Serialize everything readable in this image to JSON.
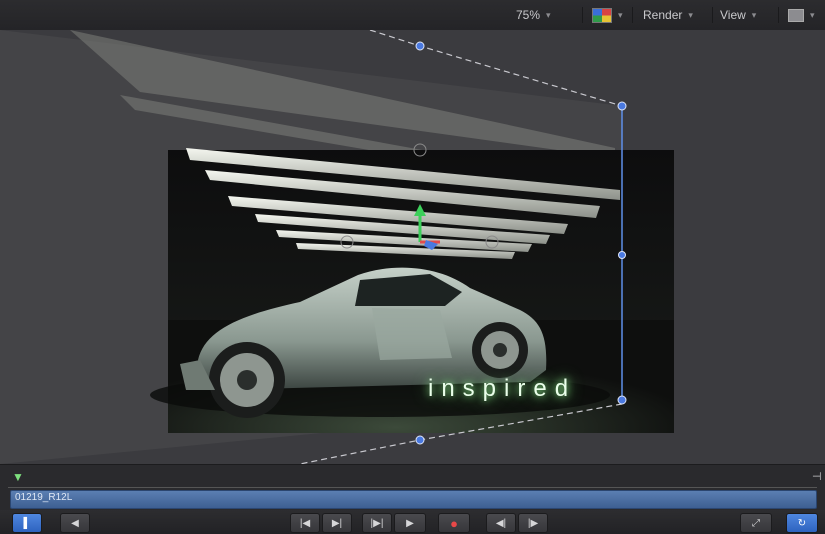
{
  "toolbar": {
    "zoom": "75%",
    "render_label": "Render",
    "view_label": "View"
  },
  "canvas": {
    "text_layer": "inspired"
  },
  "timeline": {
    "clip_label": "01219_R12L"
  },
  "icons": {
    "chevron": "chevron-down-icon",
    "play": "play-icon"
  }
}
